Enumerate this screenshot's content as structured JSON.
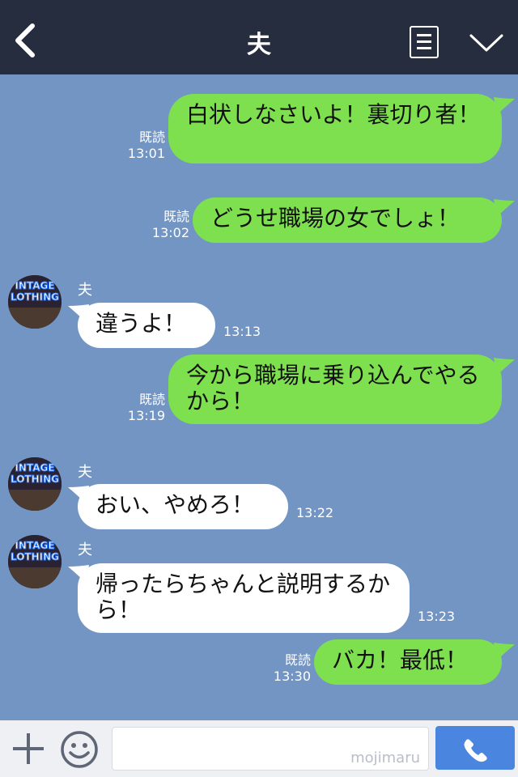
{
  "header": {
    "title": "夫"
  },
  "messages": [
    {
      "side": "right",
      "text": "白状しなさいよ！裏切り者！",
      "read": "既読",
      "time": "13:01"
    },
    {
      "side": "right",
      "text": "どうせ職場の女でしょ！",
      "read": "既読",
      "time": "13:02"
    },
    {
      "side": "left",
      "sender": "夫",
      "text": "違うよ！",
      "time": "13:13",
      "avatar_text": "INTAGE LOTHING"
    },
    {
      "side": "right",
      "text": "今から職場に乗り込んでやるから！",
      "read": "既読",
      "time": "13:19"
    },
    {
      "side": "left",
      "sender": "夫",
      "text": "おい、やめろ！",
      "time": "13:22",
      "avatar_text": "INTAGE LOTHING"
    },
    {
      "side": "left",
      "sender": "夫",
      "text": "帰ったらちゃんと説明するから！",
      "time": "13:23",
      "avatar_text": "INTAGE LOTHING"
    },
    {
      "side": "right",
      "text": "バカ！最低！",
      "read": "既読",
      "time": "13:30"
    }
  ],
  "bottom": {
    "watermark": "mojimaru"
  },
  "icons": {
    "back": "chevron-left-icon",
    "menu": "list-icon",
    "collapse": "chevron-down-icon",
    "add": "plus-icon",
    "emoji": "smiley-icon",
    "call": "phone-icon"
  },
  "colors": {
    "header": "#252d3f",
    "background": "#7395c3",
    "bubble_self": "#7ee04f",
    "bubble_other": "#ffffff",
    "call_button": "#4a86e0"
  }
}
